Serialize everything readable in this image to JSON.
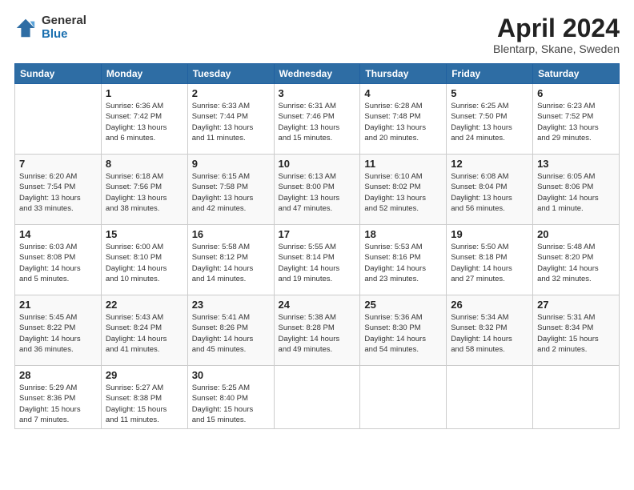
{
  "header": {
    "logo_general": "General",
    "logo_blue": "Blue",
    "main_title": "April 2024",
    "subtitle": "Blentarp, Skane, Sweden"
  },
  "columns": [
    "Sunday",
    "Monday",
    "Tuesday",
    "Wednesday",
    "Thursday",
    "Friday",
    "Saturday"
  ],
  "weeks": [
    [
      {
        "day": "",
        "info": ""
      },
      {
        "day": "1",
        "info": "Sunrise: 6:36 AM\nSunset: 7:42 PM\nDaylight: 13 hours\nand 6 minutes."
      },
      {
        "day": "2",
        "info": "Sunrise: 6:33 AM\nSunset: 7:44 PM\nDaylight: 13 hours\nand 11 minutes."
      },
      {
        "day": "3",
        "info": "Sunrise: 6:31 AM\nSunset: 7:46 PM\nDaylight: 13 hours\nand 15 minutes."
      },
      {
        "day": "4",
        "info": "Sunrise: 6:28 AM\nSunset: 7:48 PM\nDaylight: 13 hours\nand 20 minutes."
      },
      {
        "day": "5",
        "info": "Sunrise: 6:25 AM\nSunset: 7:50 PM\nDaylight: 13 hours\nand 24 minutes."
      },
      {
        "day": "6",
        "info": "Sunrise: 6:23 AM\nSunset: 7:52 PM\nDaylight: 13 hours\nand 29 minutes."
      }
    ],
    [
      {
        "day": "7",
        "info": "Sunrise: 6:20 AM\nSunset: 7:54 PM\nDaylight: 13 hours\nand 33 minutes."
      },
      {
        "day": "8",
        "info": "Sunrise: 6:18 AM\nSunset: 7:56 PM\nDaylight: 13 hours\nand 38 minutes."
      },
      {
        "day": "9",
        "info": "Sunrise: 6:15 AM\nSunset: 7:58 PM\nDaylight: 13 hours\nand 42 minutes."
      },
      {
        "day": "10",
        "info": "Sunrise: 6:13 AM\nSunset: 8:00 PM\nDaylight: 13 hours\nand 47 minutes."
      },
      {
        "day": "11",
        "info": "Sunrise: 6:10 AM\nSunset: 8:02 PM\nDaylight: 13 hours\nand 52 minutes."
      },
      {
        "day": "12",
        "info": "Sunrise: 6:08 AM\nSunset: 8:04 PM\nDaylight: 13 hours\nand 56 minutes."
      },
      {
        "day": "13",
        "info": "Sunrise: 6:05 AM\nSunset: 8:06 PM\nDaylight: 14 hours\nand 1 minute."
      }
    ],
    [
      {
        "day": "14",
        "info": "Sunrise: 6:03 AM\nSunset: 8:08 PM\nDaylight: 14 hours\nand 5 minutes."
      },
      {
        "day": "15",
        "info": "Sunrise: 6:00 AM\nSunset: 8:10 PM\nDaylight: 14 hours\nand 10 minutes."
      },
      {
        "day": "16",
        "info": "Sunrise: 5:58 AM\nSunset: 8:12 PM\nDaylight: 14 hours\nand 14 minutes."
      },
      {
        "day": "17",
        "info": "Sunrise: 5:55 AM\nSunset: 8:14 PM\nDaylight: 14 hours\nand 19 minutes."
      },
      {
        "day": "18",
        "info": "Sunrise: 5:53 AM\nSunset: 8:16 PM\nDaylight: 14 hours\nand 23 minutes."
      },
      {
        "day": "19",
        "info": "Sunrise: 5:50 AM\nSunset: 8:18 PM\nDaylight: 14 hours\nand 27 minutes."
      },
      {
        "day": "20",
        "info": "Sunrise: 5:48 AM\nSunset: 8:20 PM\nDaylight: 14 hours\nand 32 minutes."
      }
    ],
    [
      {
        "day": "21",
        "info": "Sunrise: 5:45 AM\nSunset: 8:22 PM\nDaylight: 14 hours\nand 36 minutes."
      },
      {
        "day": "22",
        "info": "Sunrise: 5:43 AM\nSunset: 8:24 PM\nDaylight: 14 hours\nand 41 minutes."
      },
      {
        "day": "23",
        "info": "Sunrise: 5:41 AM\nSunset: 8:26 PM\nDaylight: 14 hours\nand 45 minutes."
      },
      {
        "day": "24",
        "info": "Sunrise: 5:38 AM\nSunset: 8:28 PM\nDaylight: 14 hours\nand 49 minutes."
      },
      {
        "day": "25",
        "info": "Sunrise: 5:36 AM\nSunset: 8:30 PM\nDaylight: 14 hours\nand 54 minutes."
      },
      {
        "day": "26",
        "info": "Sunrise: 5:34 AM\nSunset: 8:32 PM\nDaylight: 14 hours\nand 58 minutes."
      },
      {
        "day": "27",
        "info": "Sunrise: 5:31 AM\nSunset: 8:34 PM\nDaylight: 15 hours\nand 2 minutes."
      }
    ],
    [
      {
        "day": "28",
        "info": "Sunrise: 5:29 AM\nSunset: 8:36 PM\nDaylight: 15 hours\nand 7 minutes."
      },
      {
        "day": "29",
        "info": "Sunrise: 5:27 AM\nSunset: 8:38 PM\nDaylight: 15 hours\nand 11 minutes."
      },
      {
        "day": "30",
        "info": "Sunrise: 5:25 AM\nSunset: 8:40 PM\nDaylight: 15 hours\nand 15 minutes."
      },
      {
        "day": "",
        "info": ""
      },
      {
        "day": "",
        "info": ""
      },
      {
        "day": "",
        "info": ""
      },
      {
        "day": "",
        "info": ""
      }
    ]
  ]
}
